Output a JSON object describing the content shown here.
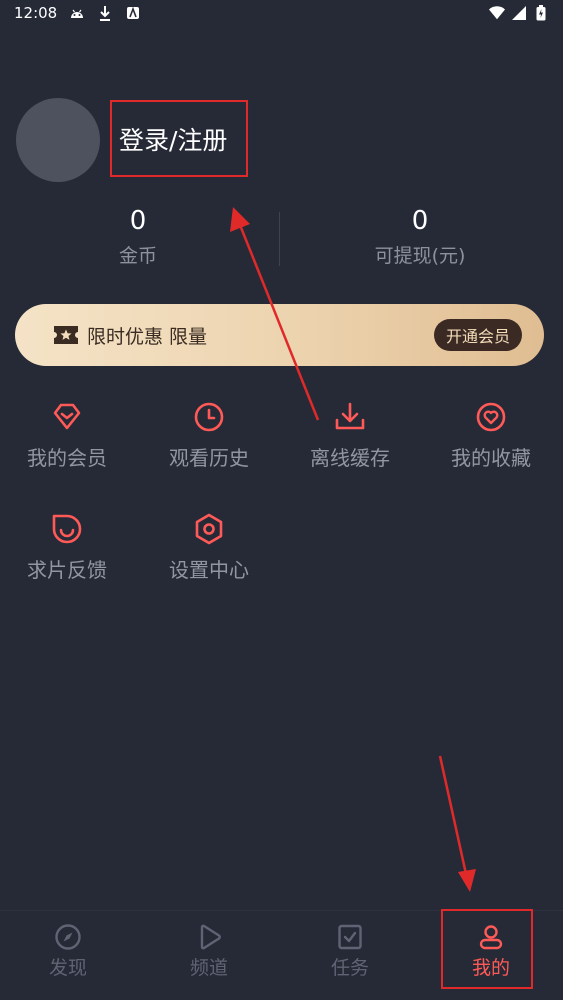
{
  "status_bar": {
    "time": "12:08",
    "battery_icon": "battery-charging-icon"
  },
  "profile": {
    "login_label": "登录/注册"
  },
  "stats": [
    {
      "value": "0",
      "label": "金币"
    },
    {
      "value": "0",
      "label": "可提现(元)"
    }
  ],
  "vip_banner": {
    "text": "限时优惠 限量",
    "button_label": "开通会员"
  },
  "menu": [
    {
      "label": "我的会员",
      "icon": "diamond-icon"
    },
    {
      "label": "观看历史",
      "icon": "clock-icon"
    },
    {
      "label": "离线缓存",
      "icon": "download-icon"
    },
    {
      "label": "我的收藏",
      "icon": "heart-icon"
    },
    {
      "label": "求片反馈",
      "icon": "feedback-smile-icon"
    },
    {
      "label": "设置中心",
      "icon": "hexagon-settings-icon"
    }
  ],
  "tabs": [
    {
      "label": "发现",
      "icon": "compass-icon"
    },
    {
      "label": "频道",
      "icon": "play-icon"
    },
    {
      "label": "任务",
      "icon": "task-check-icon"
    },
    {
      "label": "我的",
      "icon": "user-icon"
    }
  ],
  "colors": {
    "accent": "#ff5a57",
    "background": "#262a37",
    "annotation": "#e02a2a"
  }
}
